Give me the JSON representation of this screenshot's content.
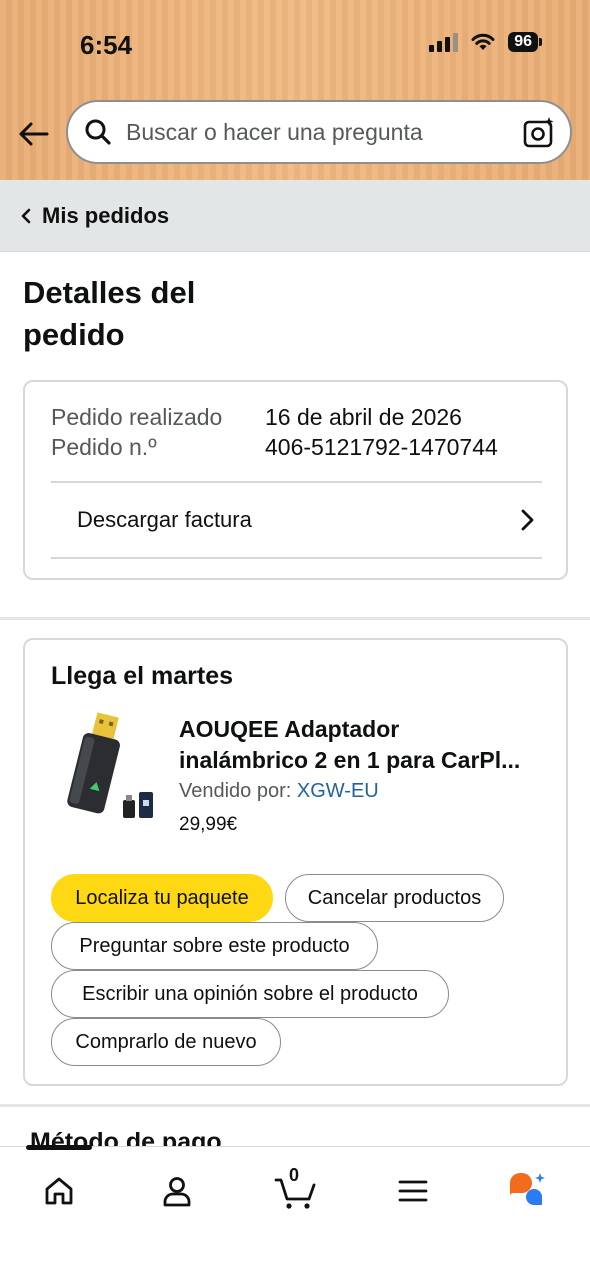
{
  "status_bar": {
    "time": "6:54",
    "battery": "96"
  },
  "search": {
    "placeholder": "Buscar o hacer una pregunta"
  },
  "breadcrumb": {
    "label": "Mis pedidos"
  },
  "page": {
    "title": "Detalles del pedido"
  },
  "order_info": {
    "placed_label": "Pedido realizado",
    "placed_value": "16 de abril de 2026",
    "number_label": "Pedido n.º",
    "number_value": "406-5121792-1470744",
    "invoice_label": "Descargar factura"
  },
  "shipment": {
    "title": "Llega el martes",
    "product": {
      "title_line1": "AOUQEE Adaptador",
      "title_line2": "inalámbrico 2 en 1 para CarPl...",
      "seller_label": "Vendido por:",
      "seller_name": "XGW-EU",
      "price": "29,99€"
    },
    "actions": {
      "track": "Localiza tu paquete",
      "cancel": "Cancelar productos",
      "ask": "Preguntar sobre este producto",
      "review": "Escribir una opinión sobre el producto",
      "buy_again": "Comprarlo de nuevo"
    }
  },
  "next_section": {
    "title": "Método de pago"
  },
  "bottom_nav": {
    "cart_count": "0"
  },
  "colors": {
    "header": "#f1b982",
    "primary_button": "#ffd814",
    "link": "#2162a1",
    "assistant_orange": "#f36b1c",
    "assistant_blue": "#2a7cf6"
  }
}
